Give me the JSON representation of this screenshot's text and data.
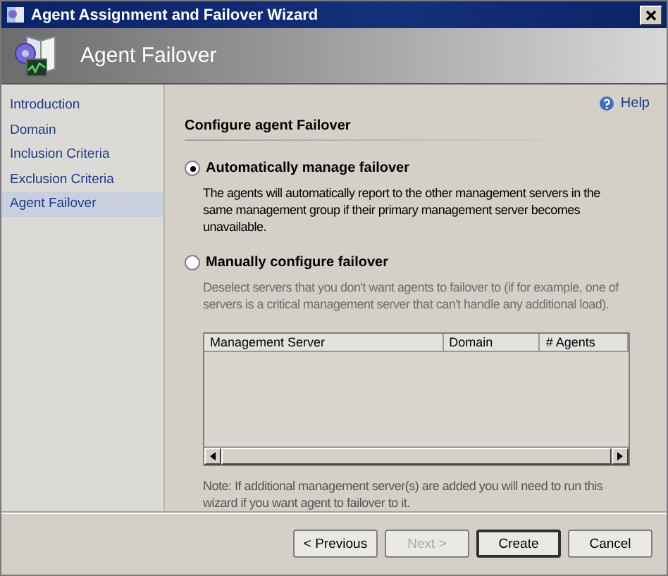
{
  "window": {
    "title": "Agent Assignment and Failover Wizard"
  },
  "header": {
    "title": "Agent Failover"
  },
  "sidebar": {
    "items": [
      {
        "label": "Introduction",
        "selected": false
      },
      {
        "label": "Domain",
        "selected": false
      },
      {
        "label": "Inclusion Criteria",
        "selected": false
      },
      {
        "label": "Exclusion Criteria",
        "selected": false
      },
      {
        "label": "Agent Failover",
        "selected": true
      }
    ]
  },
  "help": "Help",
  "section_title": "Configure agent Failover",
  "options": [
    {
      "label": "Automatically manage failover",
      "description": "The agents will automatically report to the other management servers in the same management group if their primary management server becomes unavailable.",
      "selected": true
    },
    {
      "label": "Manually configure failover",
      "description": "Deselect servers that you don't want agents to failover to (if for example, one of servers is a critical management server that can't handle any additional load).",
      "selected": false
    }
  ],
  "table": {
    "columns": [
      "Management Server",
      "Domain",
      "# Agents"
    ]
  },
  "note": "Note: If additional management server(s) are added you will need to run this wizard if you want agent to failover to it.",
  "buttons": [
    {
      "label": "< Previous",
      "disabled": false,
      "default": false
    },
    {
      "label": "Next >",
      "disabled": true,
      "default": false
    },
    {
      "label": "Create",
      "disabled": false,
      "default": true
    },
    {
      "label": "Cancel",
      "disabled": false,
      "default": false
    }
  ]
}
